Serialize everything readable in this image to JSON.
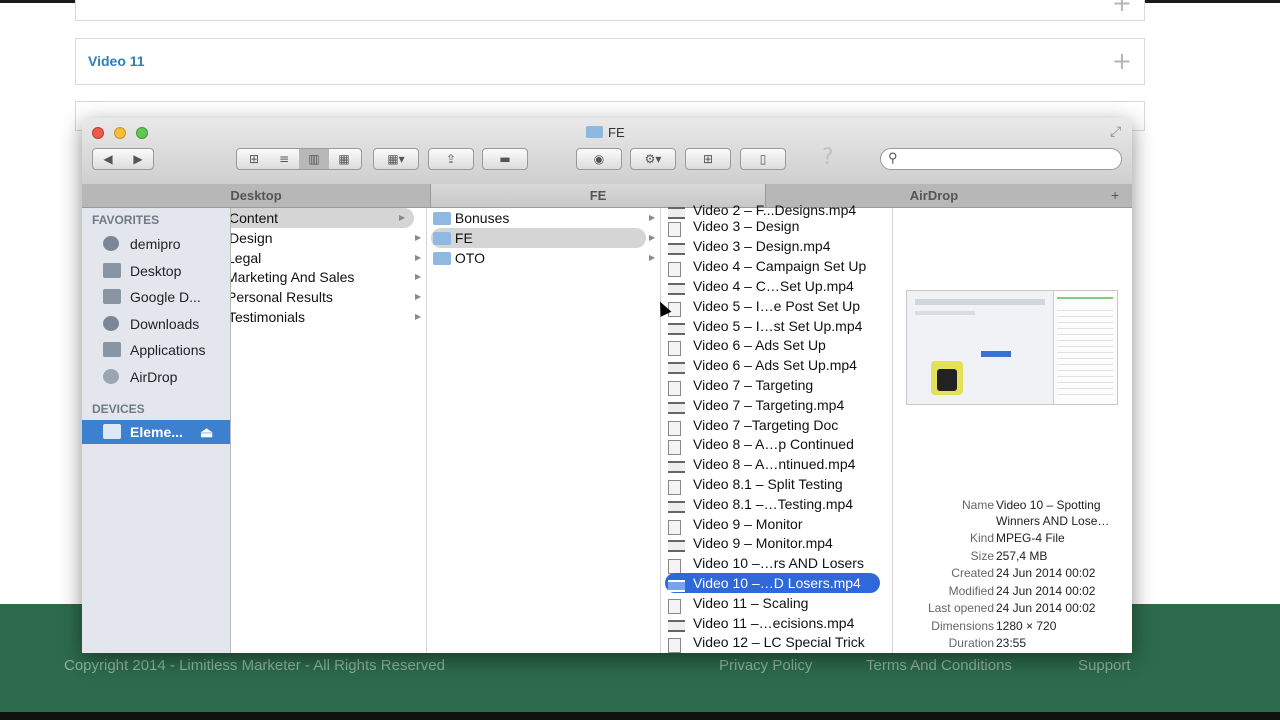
{
  "background": {
    "accordion_items": [
      "Video 11"
    ],
    "footer": {
      "copyright": "Copyright 2014 - Limitless Marketer - All Rights Reserved",
      "links": [
        "Privacy Policy",
        "Terms And Conditions",
        "Support"
      ]
    }
  },
  "finder": {
    "title": "FE",
    "tabs": [
      "Desktop",
      "FE",
      "AirDrop"
    ],
    "sidebar": {
      "favorites_header": "FAVORITES",
      "favorites": [
        "demipro",
        "Desktop",
        "Google D...",
        "Downloads",
        "Applications",
        "AirDrop"
      ],
      "devices_header": "DEVICES",
      "devices": [
        "Eleme..."
      ]
    },
    "column1": [
      "Content",
      "Design",
      "Legal",
      "Marketing And Sales",
      "Personal Results",
      "Testimonials"
    ],
    "column2": [
      "Bonuses",
      "FE",
      "OTO"
    ],
    "column3": [
      "Video 2 – F...Designs.mp4",
      "Video 3 – Design",
      "Video 3 – Design.mp4",
      "Video 4 – Campaign Set Up",
      "Video 4 – C…Set Up.mp4",
      "Video 5 – I…e Post Set Up",
      "Video 5 – I…st Set Up.mp4",
      "Video 6 – Ads Set Up",
      "Video 6 – Ads Set Up.mp4",
      "Video 7 – Targeting",
      "Video 7 – Targeting.mp4",
      "Video 7 –Targeting Doc",
      "Video 8 – A…p Continued",
      "Video 8 – A…ntinued.mp4",
      "Video 8.1 – Split Testing",
      "Video 8.1 –…Testing.mp4",
      "Video 9 – Monitor",
      "Video 9 – Monitor.mp4",
      "Video 10 –…rs AND Losers",
      "Video 10 –…D Losers.mp4",
      "Video 11 – Scaling",
      "Video 11 –…ecisions.mp4",
      "Video 12 – LC Special Trick"
    ],
    "column3_selected": "Video 10 –…D Losers.mp4",
    "info": {
      "name_label": "Name",
      "name": "Video 10 – Spotting",
      "name2": "Winners AND Lose…",
      "kind_label": "Kind",
      "kind": "MPEG-4 File",
      "size_label": "Size",
      "size": "257,4 MB",
      "created_label": "Created",
      "created": "24 Jun 2014 00:02",
      "modified_label": "Modified",
      "modified": "24 Jun 2014 00:02",
      "opened_label": "Last opened",
      "opened": "24 Jun 2014 00:02",
      "dimensions_label": "Dimensions",
      "dimensions": "1280 × 720",
      "duration_label": "Duration",
      "duration": "23:55"
    },
    "icons": {
      "back": "◀",
      "forward": "▶",
      "eye": "◉",
      "gear": "⚙",
      "trash": "🗑",
      "search": "⚲",
      "help": "?",
      "plus": "+",
      "eject": "⏏"
    }
  }
}
